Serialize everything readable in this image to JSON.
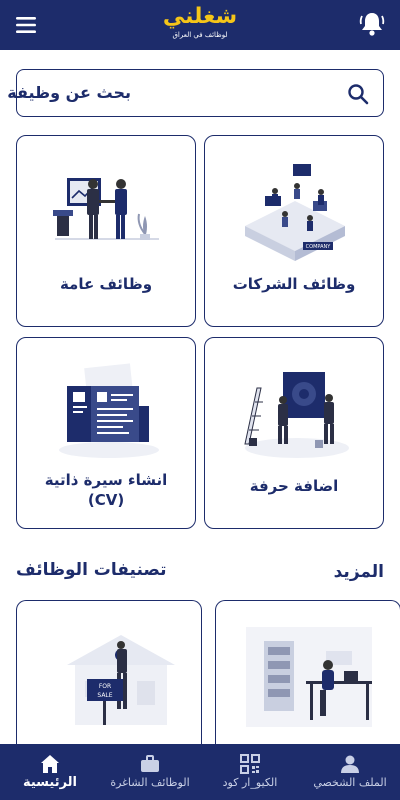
{
  "header": {
    "logo_text": "شغلني",
    "logo_tagline": "لوظائف في العراق"
  },
  "search": {
    "label": "بحث عن وظيفة"
  },
  "cards": [
    {
      "title": "وظائف الشركات"
    },
    {
      "title": "وظائف عامة"
    },
    {
      "title": "اضافة حرفة"
    },
    {
      "title_line1": "انشاء سيرة ذاتية",
      "title_line2": "(CV)"
    }
  ],
  "sections": {
    "more": "المزيد",
    "categories": "تصنيفات الوظائف"
  },
  "bottom_nav": [
    {
      "label": "الملف الشخصي"
    },
    {
      "label": "الكيو_ار كود"
    },
    {
      "label": "الوظائف الشاغرة"
    },
    {
      "label": "الرئيسية"
    }
  ],
  "colors": {
    "primary": "#1d2c6b",
    "accent": "#f5c518"
  }
}
